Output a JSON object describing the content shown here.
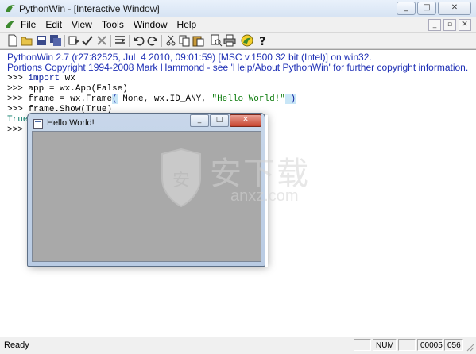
{
  "window": {
    "title": "PythonWin - [Interactive Window]"
  },
  "menu": {
    "items": [
      "File",
      "Edit",
      "View",
      "Tools",
      "Window",
      "Help"
    ]
  },
  "toolbar": {
    "icons": [
      "new-file-icon",
      "open-folder-icon",
      "save-icon",
      "save-all-icon",
      "run-icon",
      "check-icon",
      "watch-icon",
      "mark-icon",
      "undo-icon",
      "redo-icon",
      "cut-icon",
      "copy-icon",
      "paste-icon",
      "print-preview-icon",
      "print-icon",
      "python-icon",
      "help-icon"
    ]
  },
  "console": {
    "banner_1": "PythonWin 2.7 (r27:82525, Jul  4 2010, 09:01:59) [MSC v.1500 32 bit (Intel)] on win32.",
    "banner_2": "Portions Copyright 1994-2008 Mark Hammond - see 'Help/About PythonWin' for further copyright information.",
    "prompt": ">>>",
    "line_1_kw": "import",
    "line_1_rest": " wx",
    "line_2": "app = wx.App(False)",
    "line_3_pre": "frame = wx.Frame",
    "line_3_open": "(",
    "line_3_mid": " None, wx.ID_ANY, ",
    "line_3_str": "\"Hello World!\"",
    "line_3_close": " )",
    "line_4": "frame.Show(True)",
    "output": "True"
  },
  "child_window": {
    "title": "Hello World!"
  },
  "watermark": {
    "text": "安下载",
    "domain": "anxz.com"
  },
  "statusbar": {
    "status": "Ready",
    "num": "NUM",
    "line": "00005",
    "col": "056"
  },
  "colors": {
    "banner": "#1e2fb5",
    "child_client": "#a9a9a9"
  }
}
